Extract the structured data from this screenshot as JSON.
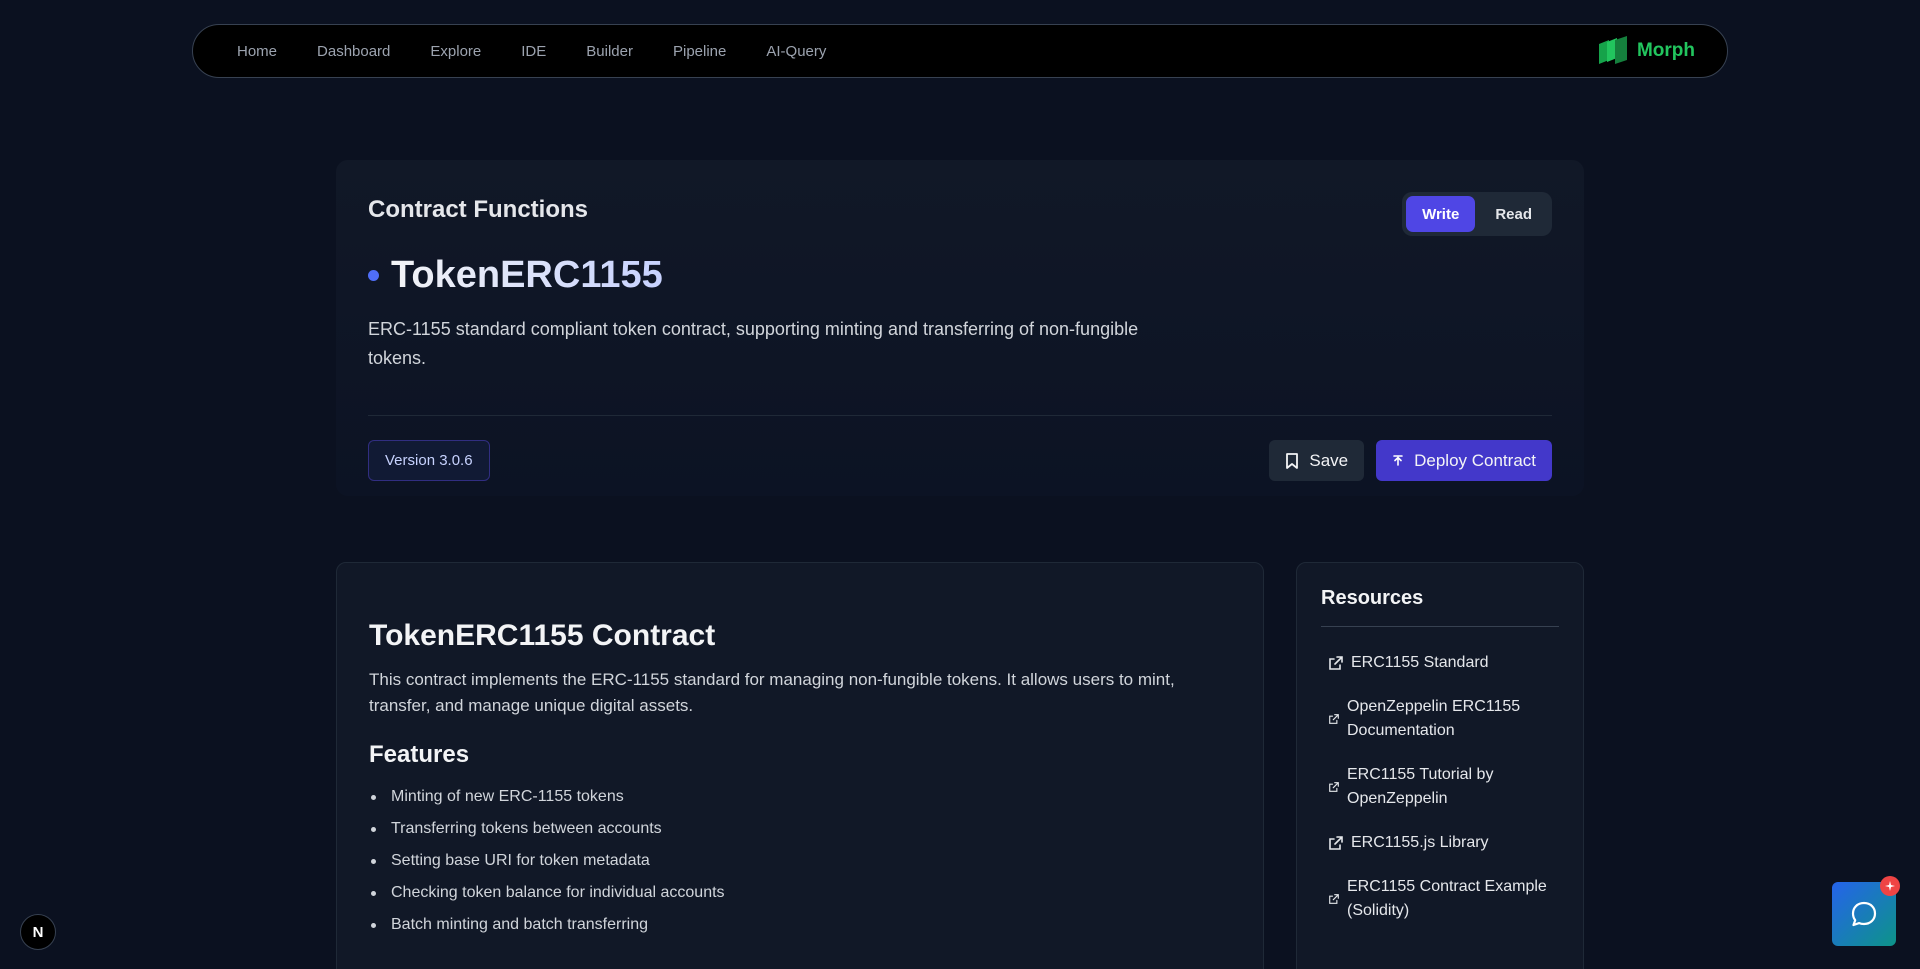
{
  "nav": {
    "links": [
      "Home",
      "Dashboard",
      "Explore",
      "IDE",
      "Builder",
      "Pipeline",
      "AI-Query"
    ],
    "brand": "Morph",
    "brand_icon": "morph-logo-icon"
  },
  "hero": {
    "section_title": "Contract Functions",
    "toggle": {
      "write_label": "Write",
      "read_label": "Read",
      "active": "Write"
    },
    "token_name": "TokenERC1155",
    "description": "ERC-1155 standard compliant token contract, supporting minting and transferring of non-fungible tokens.",
    "version": "Version 3.0.6",
    "save_label": "Save",
    "deploy_label": "Deploy Contract"
  },
  "content": {
    "title": "TokenERC1155 Contract",
    "description": "This contract implements the ERC-1155 standard for managing non-fungible tokens. It allows users to mint, transfer, and manage unique digital assets.",
    "features_title": "Features",
    "features": [
      "Minting of new ERC-1155 tokens",
      "Transferring tokens between accounts",
      "Setting base URI for token metadata",
      "Checking token balance for individual accounts",
      "Batch minting and batch transferring"
    ]
  },
  "resources": {
    "title": "Resources",
    "items": [
      "ERC1155 Standard",
      "OpenZeppelin ERC1155 Documentation",
      "ERC1155 Tutorial by OpenZeppelin",
      "ERC1155.js Library",
      "ERC1155 Contract Example (Solidity)"
    ]
  },
  "floating": {
    "dev_badge": "N",
    "chat_icon": "chat-bubble-icon"
  },
  "colors": {
    "background": "#0b1120",
    "accent": "#4f46e5",
    "brand": "#22c55e"
  }
}
